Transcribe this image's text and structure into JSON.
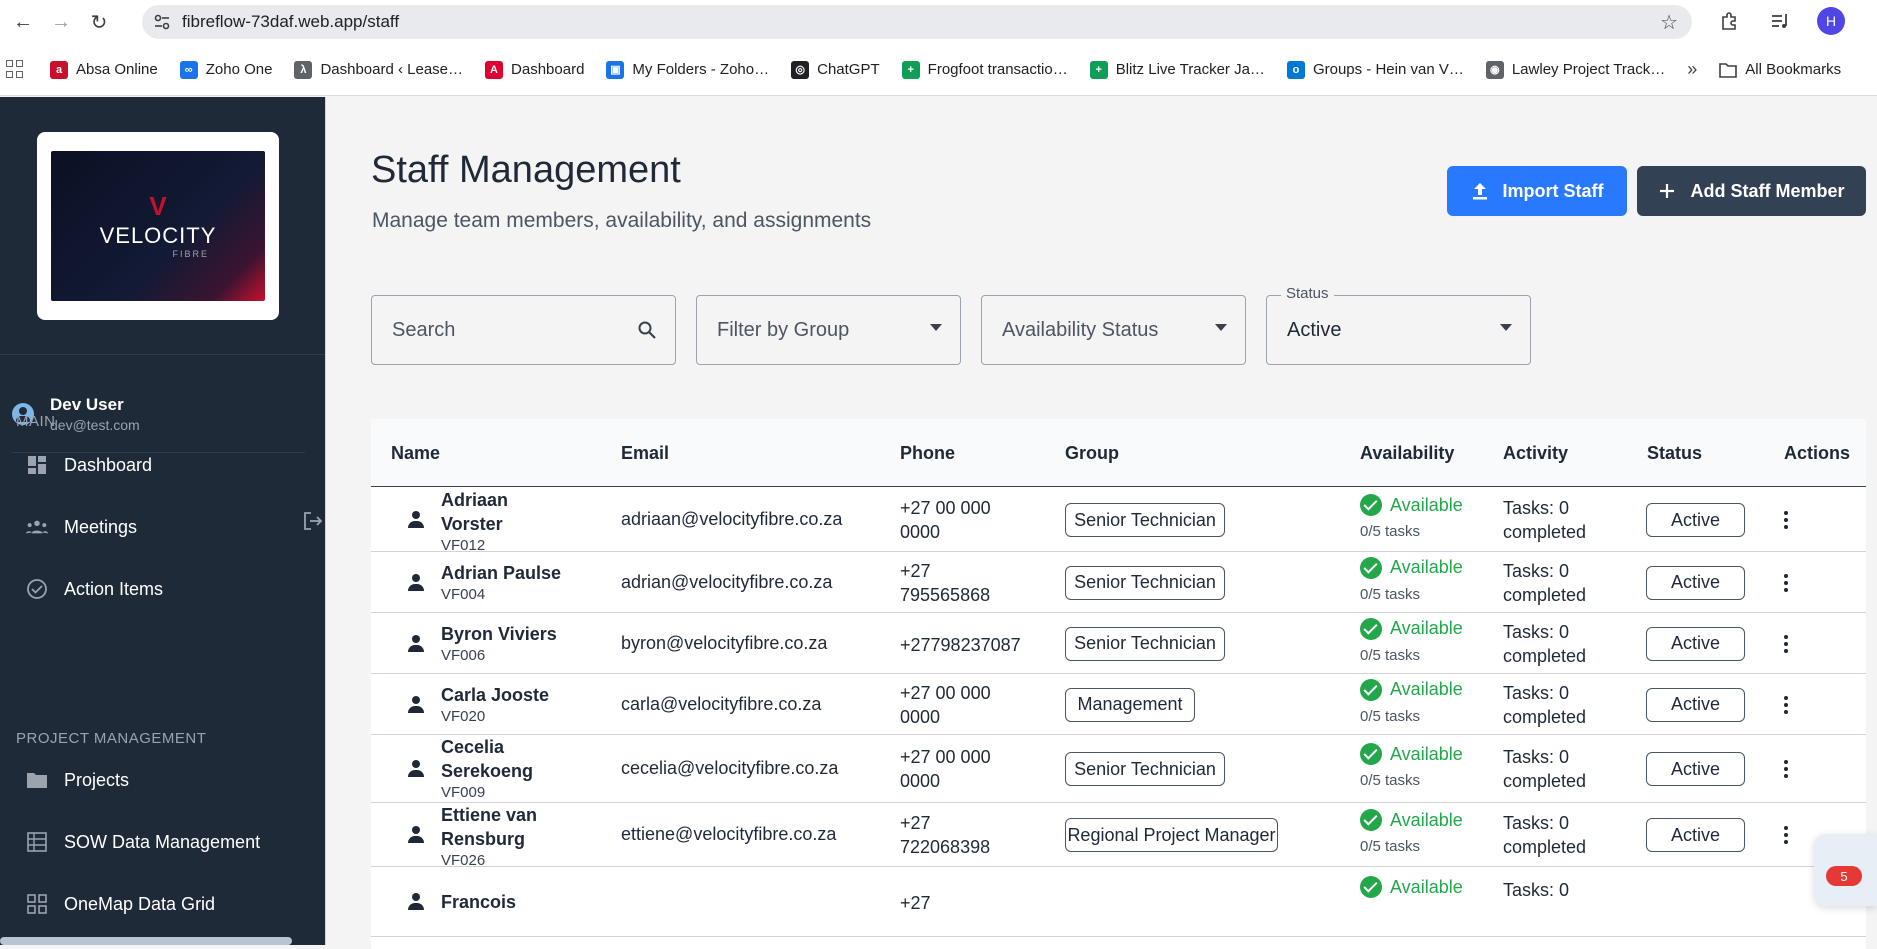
{
  "browser": {
    "url": "fibreflow-73daf.web.app/staff",
    "profile_initial": "H",
    "bookmarks": [
      {
        "label": "Absa Online",
        "color": "#c8102e",
        "glyph": "a"
      },
      {
        "label": "Zoho One",
        "color": "#1a73e8",
        "glyph": "∞"
      },
      {
        "label": "Dashboard ‹ Lease…",
        "color": "#5f6368",
        "glyph": "λ"
      },
      {
        "label": "Dashboard",
        "color": "#dd0031",
        "glyph": "A"
      },
      {
        "label": "My Folders - Zoho…",
        "color": "#1a73e8",
        "glyph": "▣"
      },
      {
        "label": "ChatGPT",
        "color": "#202124",
        "glyph": "◎"
      },
      {
        "label": "Frogfoot transactio…",
        "color": "#0f9d58",
        "glyph": "+"
      },
      {
        "label": "Blitz Live Tracker Ja…",
        "color": "#0f9d58",
        "glyph": "+"
      },
      {
        "label": "Groups - Hein van V…",
        "color": "#0078d4",
        "glyph": "o"
      },
      {
        "label": "Lawley Project Track…",
        "color": "#5f6368",
        "glyph": "◉"
      }
    ],
    "more": "»",
    "all_bookmarks": "All Bookmarks"
  },
  "sidebar": {
    "logo_text": "VELOCITY",
    "logo_sub": "FIBRE",
    "user_name": "Dev User",
    "user_email": "dev@test.com",
    "section_main": "MAIN",
    "section_pm": "PROJECT MANAGEMENT",
    "items": [
      {
        "label": "Dashboard",
        "icon": "dashboard-icon"
      },
      {
        "label": "Meetings",
        "icon": "groups-icon"
      },
      {
        "label": "Action Items",
        "icon": "check-circle-icon"
      },
      {
        "label": "Projects",
        "icon": "folder-icon"
      },
      {
        "label": "SOW Data Management",
        "icon": "table-icon"
      },
      {
        "label": "OneMap Data Grid",
        "icon": "grid-icon"
      }
    ]
  },
  "header": {
    "title": "Staff Management",
    "subtitle": "Manage team members, availability, and assignments",
    "import_label": "Import Staff",
    "add_label": "Add Staff Member"
  },
  "filters": {
    "search_placeholder": "Search",
    "group_placeholder": "Filter by Group",
    "availability_placeholder": "Availability Status",
    "status_legend": "Status",
    "status_value": "Active"
  },
  "table": {
    "columns": [
      "Name",
      "Email",
      "Phone",
      "Group",
      "Availability",
      "Activity",
      "Status",
      "Actions"
    ],
    "rows": [
      {
        "name1": "Adriaan",
        "name2": "Vorster",
        "id": "VF012",
        "email": "adriaan@velocityfibre.co.za",
        "phone1": "+27 00 000",
        "phone2": "0000",
        "group": "Senior Technician",
        "availability": "Available",
        "tasks": "0/5 tasks",
        "activity1": "Tasks: 0",
        "activity2": "completed",
        "status": "Active"
      },
      {
        "name1": "Adrian Paulse",
        "name2": "",
        "id": "VF004",
        "email": "adrian@velocityfibre.co.za",
        "phone1": "+27",
        "phone2": "795565868",
        "group": "Senior Technician",
        "availability": "Available",
        "tasks": "0/5 tasks",
        "activity1": "Tasks: 0",
        "activity2": "completed",
        "status": "Active"
      },
      {
        "name1": "Byron Viviers",
        "name2": "",
        "id": "VF006",
        "email": "byron@velocityfibre.co.za",
        "phone1": "+27798237087",
        "phone2": "",
        "group": "Senior Technician",
        "availability": "Available",
        "tasks": "0/5 tasks",
        "activity1": "Tasks: 0",
        "activity2": "completed",
        "status": "Active"
      },
      {
        "name1": "Carla Jooste",
        "name2": "",
        "id": "VF020",
        "email": "carla@velocityfibre.co.za",
        "phone1": "+27 00 000",
        "phone2": "0000",
        "group": "Management",
        "availability": "Available",
        "tasks": "0/5 tasks",
        "activity1": "Tasks: 0",
        "activity2": "completed",
        "status": "Active"
      },
      {
        "name1": "Cecelia",
        "name2": "Serekoeng",
        "id": "VF009",
        "email": "cecelia@velocityfibre.co.za",
        "phone1": "+27 00 000",
        "phone2": "0000",
        "group": "Senior Technician",
        "availability": "Available",
        "tasks": "0/5 tasks",
        "activity1": "Tasks: 0",
        "activity2": "completed",
        "status": "Active"
      },
      {
        "name1": "Ettiene van",
        "name2": "Rensburg",
        "id": "VF026",
        "email": "ettiene@velocityfibre.co.za",
        "phone1": "+27",
        "phone2": "722068398",
        "group": "Regional Project Manager",
        "availability": "Available",
        "tasks": "0/5 tasks",
        "activity1": "Tasks: 0",
        "activity2": "completed",
        "status": "Active"
      },
      {
        "name1": "Francois",
        "name2": "",
        "id": "",
        "email": "",
        "phone1": "+27",
        "phone2": "",
        "group": "",
        "availability": "Available",
        "tasks": "",
        "activity1": "Tasks: 0",
        "activity2": "",
        "status": ""
      }
    ]
  },
  "notification_count": "5",
  "colors": {
    "primary": "#2979ff",
    "dark": "#334155",
    "available": "#22a84a",
    "sidebar": "#1e2a38"
  }
}
